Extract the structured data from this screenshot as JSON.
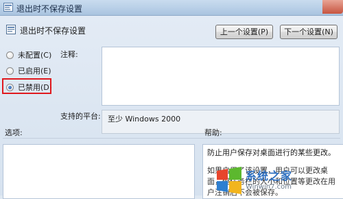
{
  "window": {
    "title": "退出时不保存设置"
  },
  "header": {
    "title": "退出时不保存设置",
    "prev_button": "上一个设置(P)",
    "next_button": "下一个设置(N)"
  },
  "state_options": [
    {
      "label": "未配置(C)",
      "checked": false
    },
    {
      "label": "已启用(E)",
      "checked": false
    },
    {
      "label": "已禁用(D)",
      "checked": true
    }
  ],
  "comment": {
    "label": "注释:",
    "value": ""
  },
  "platform": {
    "label": "支持的平台:",
    "value": "至少 Windows 2000"
  },
  "options": {
    "label": "选项:"
  },
  "help": {
    "label": "帮助:",
    "line1": "防止用户保存对桌面进行的某些更改。",
    "line2": "如果启用了该设置，用户可以更改桌面，但任务栏的大小和位置等更改在用户注销后不会被保存。"
  },
  "watermark": {
    "name": "系统之家",
    "url": "Winwin7.com"
  },
  "colors": {
    "highlight": "#e0191e",
    "accent": "#2d6fc0"
  }
}
